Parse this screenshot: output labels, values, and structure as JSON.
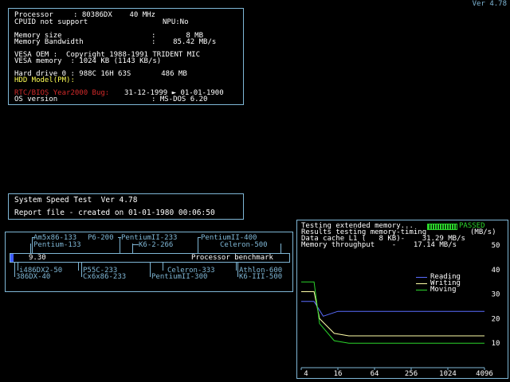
{
  "version": "Ver 4.78",
  "sysinfo": {
    "processor_label": "Processor",
    "processor_value": ": 80386DX    40 MHz",
    "cpuid": "CPUID not support",
    "npu": "NPU:No",
    "mem_size_label": "Memory size",
    "mem_size_value": ":       8 MB",
    "mem_bw_label": "Memory Bandwidth",
    "mem_bw_value": ":    85.42 MB/s",
    "vesa_oem": "VESA OEM :  Copyright 1988-1991 TRIDENT MIC",
    "vesa_memory": "VESA memory  : 1024 KB (1143 KB/s)",
    "hdd0": "Hard drive 0 : 988C 16H 63S       486 MB",
    "hdd_model": "HDD Model(PM):",
    "rtc_bug": "RTC/BIOS Year2000 Bug:",
    "rtc_value": "31-12-1999 ► 01-01-1900",
    "os_label": "OS version",
    "os_value": ": MS-DOS 6.20"
  },
  "speedtest": {
    "title": "System Speed Test  Ver 4.78",
    "report": "Report file - created on 01-01-1980 00:06:50"
  },
  "benchmark": {
    "value": "9.30",
    "label": "Processor benchmark",
    "level_fraction": 0.01,
    "top_row1": [
      "Am5x86-133",
      "P6-200",
      "PentiumII-233",
      "PentiumII-400"
    ],
    "top_row2": [
      "Pentium-133",
      "K6-2-266",
      "Celeron-500"
    ],
    "bottom_row1": [
      "i486DX2-50",
      "P55C-233",
      "Celeron-333",
      "Athlon-600"
    ],
    "bottom_row2": [
      "386DX-40",
      "Cx6x86-233",
      "PentiumII-300",
      "K6-III-500"
    ]
  },
  "memtest": {
    "line1": "Testing extended memory...",
    "passed": "PASSED",
    "line2": "Results testing memory-timing",
    "unit": "(MB/s)",
    "line3": "Data cache L1 (   8 KB)-    31.29 MB/s",
    "line4": "Memory throughput    -    17.14 MB/s",
    "legend": [
      {
        "name": "Reading",
        "color": "#5a6cff"
      },
      {
        "name": "Writing",
        "color": "#ffffa8"
      },
      {
        "name": "Moving",
        "color": "#2bd42b"
      }
    ]
  },
  "chart_data": {
    "type": "line",
    "x": [
      "4",
      "16",
      "64",
      "256",
      "1024",
      "4096"
    ],
    "y_ticks": [
      "50",
      "40",
      "30",
      "20",
      "10"
    ],
    "ylim": [
      0,
      50
    ],
    "series": [
      {
        "name": "Reading",
        "color": "#5a6cff",
        "points": [
          [
            0,
            27
          ],
          [
            0.35,
            27
          ],
          [
            0.6,
            21
          ],
          [
            1,
            23
          ],
          [
            2,
            23
          ],
          [
            3,
            23
          ],
          [
            4,
            23
          ],
          [
            5,
            23
          ]
        ]
      },
      {
        "name": "Writing",
        "color": "#ffffa8",
        "points": [
          [
            0,
            31
          ],
          [
            0.35,
            31
          ],
          [
            0.5,
            20
          ],
          [
            0.9,
            14
          ],
          [
            1.3,
            13
          ],
          [
            2,
            13
          ],
          [
            3,
            13
          ],
          [
            4,
            13
          ],
          [
            5,
            13
          ]
        ]
      },
      {
        "name": "Moving",
        "color": "#2bd42b",
        "points": [
          [
            0,
            35
          ],
          [
            0.35,
            35
          ],
          [
            0.5,
            18
          ],
          [
            0.9,
            11
          ],
          [
            1.3,
            10
          ],
          [
            2,
            10
          ],
          [
            3,
            10
          ],
          [
            4,
            10
          ],
          [
            5,
            10
          ]
        ]
      }
    ]
  }
}
